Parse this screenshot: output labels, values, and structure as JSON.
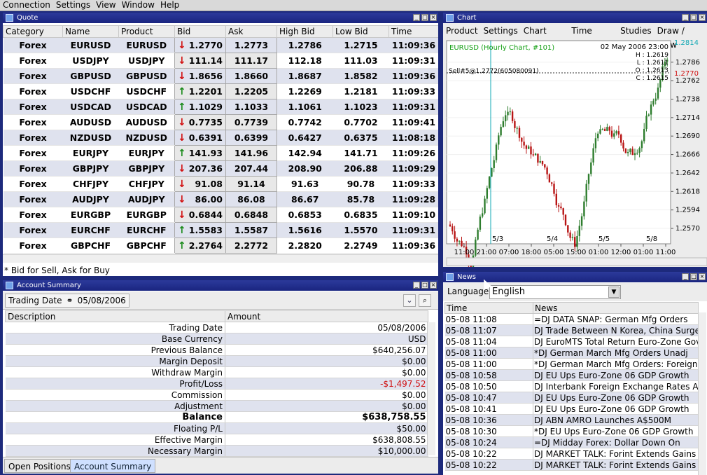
{
  "menu": [
    "Connection",
    "Settings",
    "View",
    "Window",
    "Help"
  ],
  "quote": {
    "title": "Quote",
    "columns": [
      "Category",
      "Name",
      "Product",
      "Bid",
      "Ask",
      "High Bid",
      "Low Bid",
      "Time"
    ],
    "rows": [
      {
        "cat": "Forex",
        "name": "EURUSD",
        "prod": "EURUSD",
        "dir": "down",
        "bid": "1.2770",
        "ask": "1.2773",
        "high": "1.2786",
        "low": "1.2715",
        "time": "11:09:36"
      },
      {
        "cat": "Forex",
        "name": "USDJPY",
        "prod": "USDJPY",
        "dir": "down",
        "bid": "111.14",
        "ask": "111.17",
        "high": "112.18",
        "low": "111.03",
        "time": "11:09:31"
      },
      {
        "cat": "Forex",
        "name": "GBPUSD",
        "prod": "GBPUSD",
        "dir": "down",
        "bid": "1.8656",
        "ask": "1.8660",
        "high": "1.8687",
        "low": "1.8582",
        "time": "11:09:36"
      },
      {
        "cat": "Forex",
        "name": "USDCHF",
        "prod": "USDCHF",
        "dir": "up",
        "bid": "1.2201",
        "ask": "1.2205",
        "high": "1.2269",
        "low": "1.2181",
        "time": "11:09:33"
      },
      {
        "cat": "Forex",
        "name": "USDCAD",
        "prod": "USDCAD",
        "dir": "up",
        "bid": "1.1029",
        "ask": "1.1033",
        "high": "1.1061",
        "low": "1.1023",
        "time": "11:09:31"
      },
      {
        "cat": "Forex",
        "name": "AUDUSD",
        "prod": "AUDUSD",
        "dir": "down",
        "bid": "0.7735",
        "ask": "0.7739",
        "high": "0.7742",
        "low": "0.7702",
        "time": "11:09:41"
      },
      {
        "cat": "Forex",
        "name": "NZDUSD",
        "prod": "NZDUSD",
        "dir": "down",
        "bid": "0.6391",
        "ask": "0.6399",
        "high": "0.6427",
        "low": "0.6375",
        "time": "11:08:18"
      },
      {
        "cat": "Forex",
        "name": "EURJPY",
        "prod": "EURJPY",
        "dir": "up",
        "bid": "141.93",
        "ask": "141.96",
        "high": "142.94",
        "low": "141.71",
        "time": "11:09:26"
      },
      {
        "cat": "Forex",
        "name": "GBPJPY",
        "prod": "GBPJPY",
        "dir": "down",
        "bid": "207.36",
        "ask": "207.44",
        "high": "208.90",
        "low": "206.88",
        "time": "11:09:29"
      },
      {
        "cat": "Forex",
        "name": "CHFJPY",
        "prod": "CHFJPY",
        "dir": "down",
        "bid": "91.08",
        "ask": "91.14",
        "high": "91.63",
        "low": "90.78",
        "time": "11:09:33"
      },
      {
        "cat": "Forex",
        "name": "AUDJPY",
        "prod": "AUDJPY",
        "dir": "down",
        "bid": "86.00",
        "ask": "86.08",
        "high": "86.67",
        "low": "85.78",
        "time": "11:09:28"
      },
      {
        "cat": "Forex",
        "name": "EURGBP",
        "prod": "EURGBP",
        "dir": "down",
        "bid": "0.6844",
        "ask": "0.6848",
        "high": "0.6853",
        "low": "0.6835",
        "time": "11:09:10"
      },
      {
        "cat": "Forex",
        "name": "EURCHF",
        "prod": "EURCHF",
        "dir": "up",
        "bid": "1.5583",
        "ask": "1.5587",
        "high": "1.5616",
        "low": "1.5570",
        "time": "11:09:31"
      },
      {
        "cat": "Forex",
        "name": "GBPCHF",
        "prod": "GBPCHF",
        "dir": "up",
        "bid": "2.2764",
        "ask": "2.2772",
        "high": "2.2820",
        "low": "2.2749",
        "time": "11:09:36"
      }
    ],
    "note": "* Bid for Sell, Ask for Buy"
  },
  "account": {
    "title": "Account Summary",
    "trading_date_label": "Trading Date",
    "trading_date": "05/08/2006",
    "columns": [
      "Description",
      "Amount"
    ],
    "rows": [
      {
        "desc": "Trading Date",
        "amt": "05/08/2006"
      },
      {
        "desc": "Base Currency",
        "amt": "USD"
      },
      {
        "desc": "Previous Balance",
        "amt": "$640,256.07"
      },
      {
        "desc": "Margin Deposit",
        "amt": "$0.00"
      },
      {
        "desc": "Withdraw Margin",
        "amt": "$0.00"
      },
      {
        "desc": "Profit/Loss",
        "amt": "-$1,497.52",
        "neg": true
      },
      {
        "desc": "Commission",
        "amt": "$0.00"
      },
      {
        "desc": "Adjustment",
        "amt": "$0.00"
      },
      {
        "desc": "Balance",
        "amt": "$638,758.55",
        "bold": true
      },
      {
        "desc": "Floating P/L",
        "amt": "$50.00"
      },
      {
        "desc": "Effective Margin",
        "amt": "$638,808.55"
      },
      {
        "desc": "Necessary Margin",
        "amt": "$10,000.00"
      }
    ],
    "tabs": [
      "Open Positions",
      "Account Summary"
    ],
    "active_tab": "Account Summary"
  },
  "chart_window": {
    "title": "Chart",
    "menu": [
      "Product",
      "Settings",
      "Chart Type",
      "Time Scale",
      "Studies",
      "Draw / View"
    ],
    "header_left": "EURUSD (Hourly Chart, #101)",
    "ohlc_date": "02 May 2006 23:00",
    "ohlc": [
      "H : 1.2619",
      "L : 1.2611",
      "O : 1.2613",
      "C : 1.2615"
    ],
    "order_line_label": "Sell#5@1.2772(605080091)",
    "price_top_marker": "1.2814",
    "price_sell_marker": "1.2770",
    "colors": {
      "up": "#2e7d2e",
      "down": "#b81414",
      "accent": "#12a8b4"
    }
  },
  "chart_data": {
    "type": "candlestick",
    "symbol": "EURUSD",
    "y_ticks": [
      "1.2786",
      "1.2762",
      "1.2738",
      "1.2714",
      "1.2690",
      "1.2666",
      "1.2642",
      "1.2618",
      "1.2594",
      "1.2570"
    ],
    "x_ticks": [
      "11:00",
      "21:00",
      "07:00",
      "18:00",
      "05:00",
      "15:00",
      "01:00",
      "12:00",
      "01:00",
      "11:00"
    ],
    "date_markers": [
      "5/3",
      "5/4",
      "5/5",
      "5/8"
    ],
    "ylim": [
      1.255,
      1.2814
    ]
  },
  "news": {
    "title": "News",
    "language_label": "Language",
    "language": "English",
    "columns": [
      "Time",
      "News"
    ],
    "rows": [
      {
        "time": "05-08 11:08",
        "text": "=DJ DATA SNAP: German Mfg Orders"
      },
      {
        "time": "05-08 11:07",
        "text": "DJ Trade Between N Korea, China Surges"
      },
      {
        "time": "05-08 11:04",
        "text": "DJ EuroMTS Total Return Euro-Zone Govt"
      },
      {
        "time": "05-08 11:00",
        "text": "*DJ German March Mfg Orders Unadj"
      },
      {
        "time": "05-08 11:00",
        "text": "*DJ German March Mfg Orders: Foreign"
      },
      {
        "time": "05-08 10:58",
        "text": "DJ EU Ups Euro-Zone 06 GDP Growth"
      },
      {
        "time": "05-08 10:50",
        "text": "DJ Interbank Foreign Exchange Rates At"
      },
      {
        "time": "05-08 10:47",
        "text": "DJ EU Ups Euro-Zone 06 GDP Growth"
      },
      {
        "time": "05-08 10:41",
        "text": "DJ EU Ups Euro-Zone 06 GDP Growth"
      },
      {
        "time": "05-08 10:36",
        "text": "DJ ABN AMRO Launches A$500M"
      },
      {
        "time": "05-08 10:30",
        "text": "*DJ EU Ups Euro-Zone 06 GDP Growth"
      },
      {
        "time": "05-08 10:24",
        "text": "=DJ Midday Forex: Dollar Down On"
      },
      {
        "time": "05-08 10:22",
        "text": "DJ MARKET TALK: Forint Extends Gains Vs"
      },
      {
        "time": "05-08 10:22",
        "text": "DJ MARKET TALK: Forint Extends Gains Vs"
      }
    ]
  }
}
